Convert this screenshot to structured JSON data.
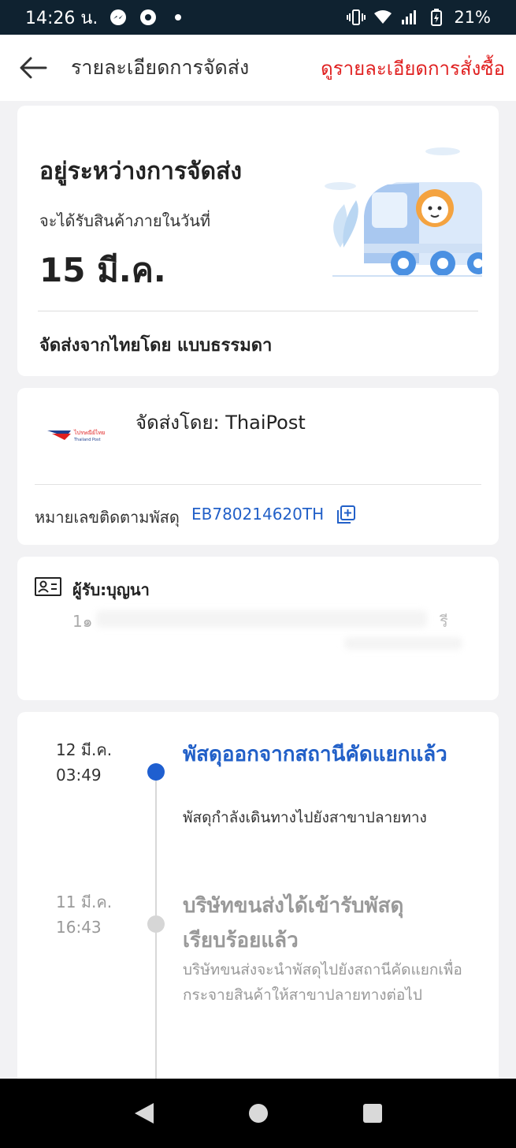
{
  "status_bar": {
    "time": "14:26 น.",
    "battery": "21%"
  },
  "header": {
    "title": "รายละเอียดการจัดส่ง",
    "order_details_link": "ดูรายละเอียดการสั่งซื้อ"
  },
  "delivery": {
    "status": "อยู่ระหว่างการจัดส่ง",
    "eta_label": "จะได้รับสินค้าภายในวันที่",
    "eta_date": "15 มี.ค.",
    "method": "จัดส่งจากไทยโดย แบบธรรมดา"
  },
  "carrier": {
    "name": "จัดส่งโดย: ThaiPost",
    "logo_text": "ไปรษณีย์ไทย",
    "logo_subtext": "Thailand Post",
    "tracking_label": "หมายเลขติดตามพัสดุ",
    "tracking_number": "EB780214620TH"
  },
  "recipient": {
    "name": "ผู้รับ:บุญนา",
    "address_fragment_1": "1๑",
    "address_fragment_2": "รี"
  },
  "timeline": [
    {
      "date": "12 มี.ค.",
      "time": "03:49",
      "title": "พัสดุออกจากสถานีคัดแยกแล้ว",
      "description": "พัสดุกำลังเดินทางไปยังสาขาปลายทาง"
    },
    {
      "date": "11 มี.ค.",
      "time": "16:43",
      "title": "บริษัทขนส่งได้เข้ารับพัสดุเรียบร้อยแล้ว",
      "description": "บริษัทขนส่งจะนำพัสดุไปยังสถานีคัดแยกเพื่อกระจายสินค้าให้สาขาปลายทางต่อไป"
    }
  ],
  "colors": {
    "accent_red": "#e02020",
    "link_blue": "#2260c8",
    "status_bar": "#0f2230"
  }
}
